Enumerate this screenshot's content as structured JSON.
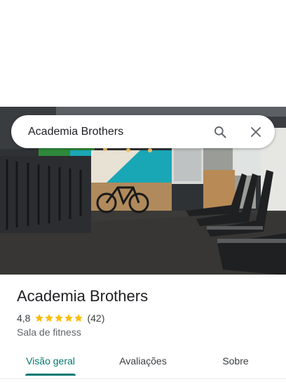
{
  "search": {
    "value": "Academia Brothers",
    "search_icon": "search-icon",
    "close_icon": "close-icon"
  },
  "photo": {
    "subject": "gym-interior-photo"
  },
  "place": {
    "name": "Academia Brothers",
    "rating": "4,8",
    "rating_value": 4.8,
    "stars_max": 5,
    "review_count": "(42)",
    "category": "Sala de fitness"
  },
  "tabs": [
    {
      "label": "Visão geral",
      "active": true
    },
    {
      "label": "Avaliações",
      "active": false
    },
    {
      "label": "Sobre",
      "active": false
    }
  ],
  "colors": {
    "accent": "#01786f",
    "star": "#fbbc04",
    "text_primary": "#202124",
    "text_secondary": "#5f6368"
  }
}
